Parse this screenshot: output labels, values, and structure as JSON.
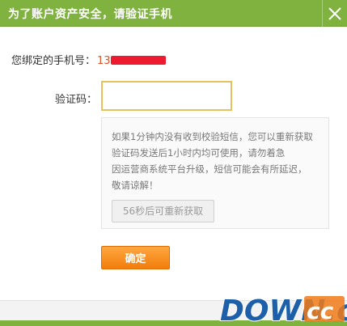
{
  "dialog": {
    "title": "为了账户资产安全，请验证手机",
    "close_icon": "close-icon"
  },
  "phone": {
    "label": "您绑定的手机号：",
    "visible_prefix": "13"
  },
  "verify": {
    "label": "验证码：",
    "value": ""
  },
  "notice": {
    "line1": "如果1分钟内没有收到校验短信，您可以重新获取",
    "line2": "验证码发送后1小时内均可使用，请勿着急",
    "line3": "因运营商系统平台升级，短信可能会有所延迟，",
    "line4": "敬请谅解！",
    "resend_label": "56秒后可重新获取"
  },
  "confirm_label": "确定",
  "watermark": {
    "text": "DOWN.cc"
  },
  "colors": {
    "titlebar": "#7fb23f",
    "phone_number": "#d8562e",
    "mask": "#ee1a2f",
    "confirm": "#f27d0c",
    "input_border": "#e6c25f"
  }
}
